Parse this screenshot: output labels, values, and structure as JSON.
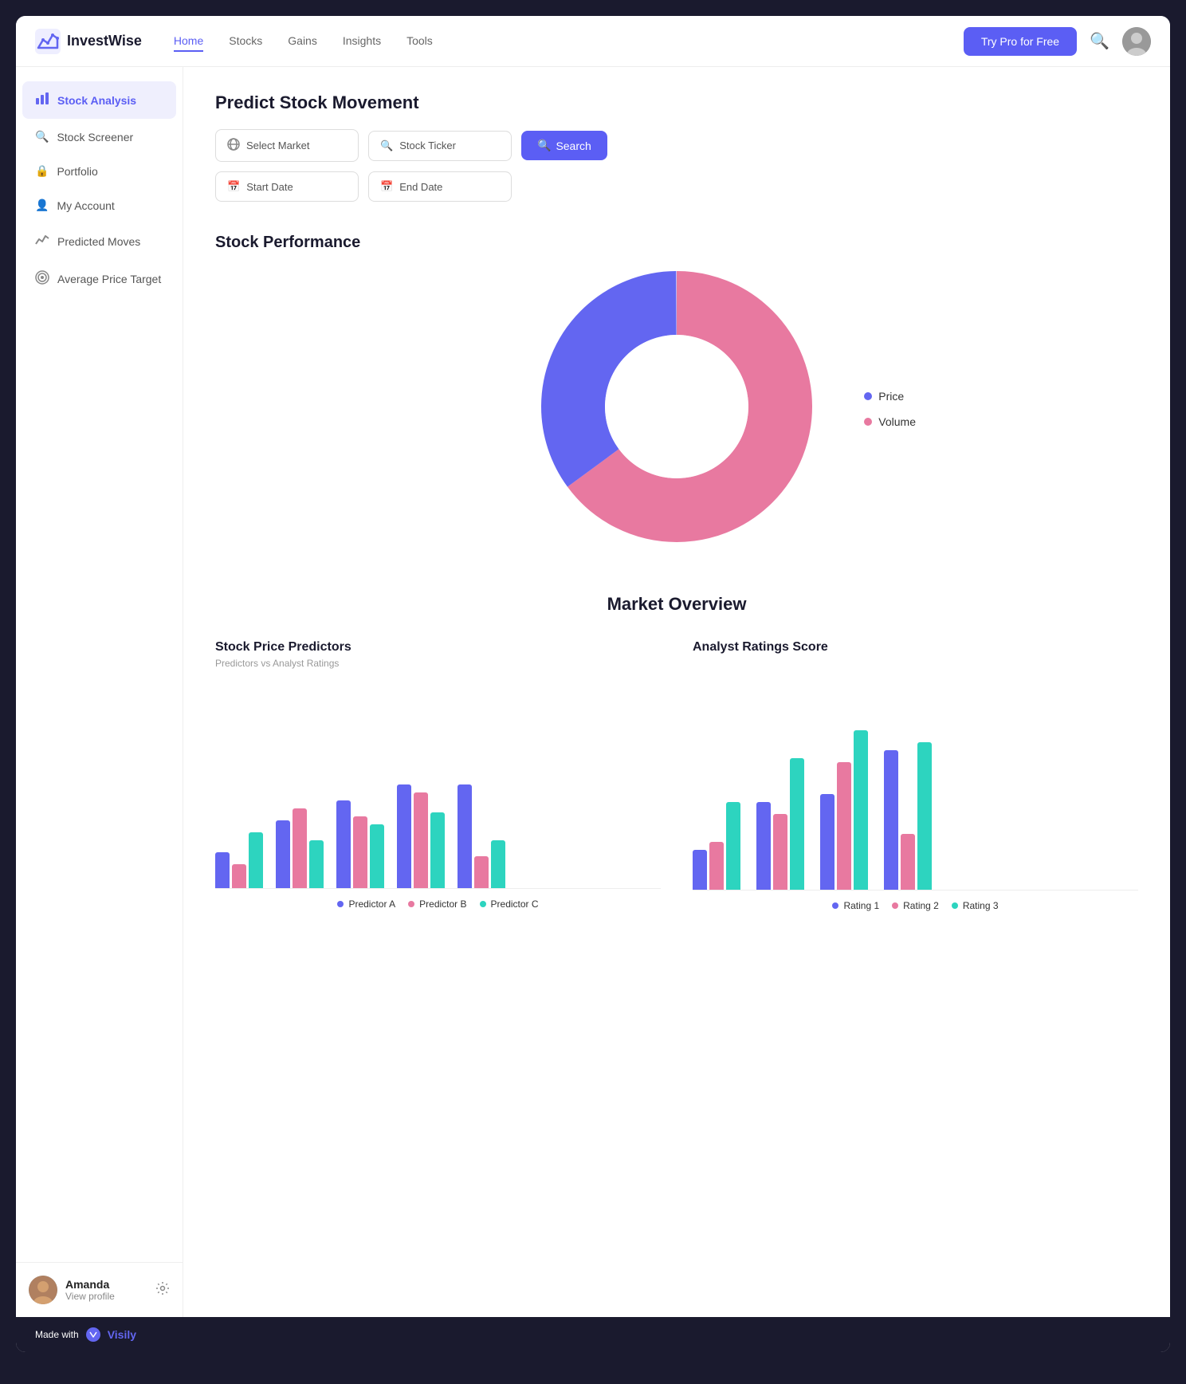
{
  "app": {
    "name": "InvestWise",
    "footer_made_with": "Made with",
    "footer_brand": "Visily"
  },
  "nav": {
    "links": [
      {
        "label": "Home",
        "active": true
      },
      {
        "label": "Stocks",
        "active": false
      },
      {
        "label": "Gains",
        "active": false
      },
      {
        "label": "Insights",
        "active": false
      },
      {
        "label": "Tools",
        "active": false
      }
    ],
    "try_pro_label": "Try Pro for Free"
  },
  "sidebar": {
    "items": [
      {
        "label": "Stock Analysis",
        "icon": "📊",
        "active": true
      },
      {
        "label": "Stock Screener",
        "icon": "🔍",
        "active": false
      },
      {
        "label": "Portfolio",
        "icon": "🔒",
        "active": false
      },
      {
        "label": "My Account",
        "icon": "👤",
        "active": false
      },
      {
        "label": "Predicted Moves",
        "icon": "📈",
        "active": false
      },
      {
        "label": "Average Price Target",
        "icon": "🎯",
        "active": false
      }
    ],
    "user": {
      "name": "Amanda",
      "action": "View profile"
    }
  },
  "predict_section": {
    "title": "Predict Stock Movement",
    "market_placeholder": "Select Market",
    "ticker_placeholder": "Stock Ticker",
    "search_label": "Search",
    "start_date_placeholder": "Start Date",
    "end_date_placeholder": "End Date"
  },
  "performance_section": {
    "title": "Stock Performance",
    "donut": {
      "price_pct": 35,
      "volume_pct": 65
    },
    "legend": [
      {
        "label": "Price",
        "color": "#6366f1"
      },
      {
        "label": "Volume",
        "color": "#e879a0"
      }
    ]
  },
  "market_overview": {
    "title": "Market Overview",
    "charts": [
      {
        "title": "Stock Price Predictors",
        "subtitle": "Predictors vs Analyst Ratings",
        "legend": [
          {
            "label": "Predictor A",
            "color": "#6366f1"
          },
          {
            "label": "Predictor B",
            "color": "#e879a0"
          },
          {
            "label": "Predictor C",
            "color": "#2dd4bf"
          }
        ],
        "groups": [
          {
            "a": 45,
            "b": 30,
            "c": 70
          },
          {
            "a": 85,
            "b": 100,
            "c": 60
          },
          {
            "a": 110,
            "b": 90,
            "c": 80
          },
          {
            "a": 130,
            "b": 120,
            "c": 95
          },
          {
            "a": 130,
            "b": 40,
            "c": 60
          }
        ]
      },
      {
        "title": "Analyst Ratings Score",
        "subtitle": "",
        "legend": [
          {
            "label": "Rating 1",
            "color": "#6366f1"
          },
          {
            "label": "Rating 2",
            "color": "#e879a0"
          },
          {
            "label": "Rating 3",
            "color": "#2dd4bf"
          }
        ],
        "groups": [
          {
            "a": 50,
            "b": 60,
            "c": 110
          },
          {
            "a": 110,
            "b": 95,
            "c": 165
          },
          {
            "a": 120,
            "b": 160,
            "c": 195
          },
          {
            "a": 175,
            "b": 70,
            "c": 180
          }
        ]
      }
    ]
  }
}
